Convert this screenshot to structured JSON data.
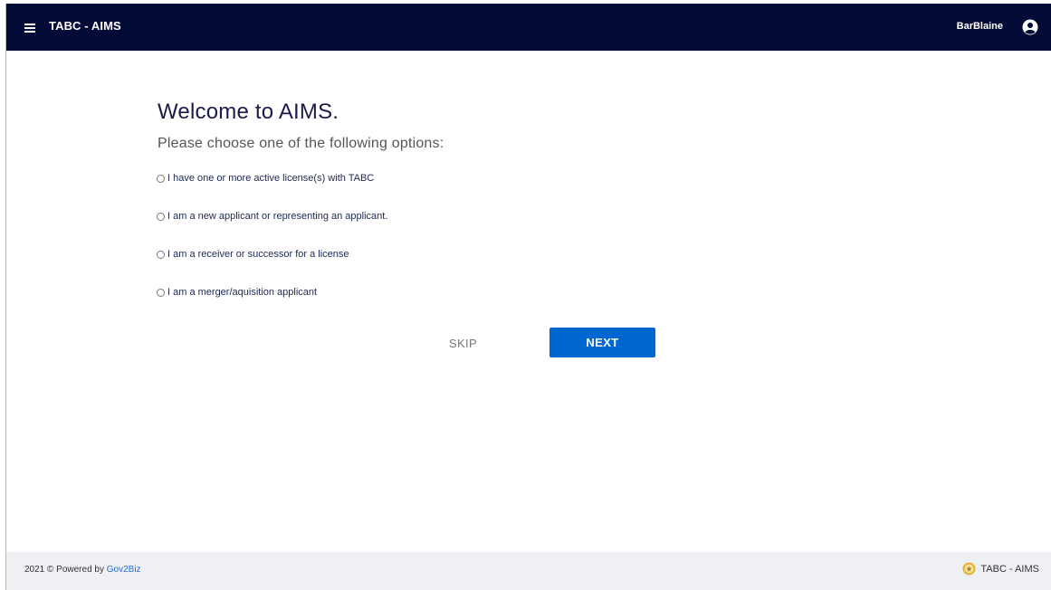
{
  "header": {
    "app_title": "TABC - AIMS",
    "username": "BarBlaine",
    "menu_icon": "hamburger-menu-icon",
    "user_icon": "user-circle-icon",
    "background_color": "#030a36"
  },
  "main": {
    "title": "Welcome to AIMS.",
    "subtitle": "Please choose one of the following options:",
    "options": [
      {
        "label": "I have one or more active license(s) with TABC"
      },
      {
        "label": "I am a new applicant or representing an applicant."
      },
      {
        "label": "I am a receiver or successor for a license"
      },
      {
        "label": "I am a merger/aquisition applicant"
      }
    ],
    "skip_label": "SKIP",
    "next_label": "NEXT",
    "next_color": "#0067d1"
  },
  "footer": {
    "copyright": "2021 © Powered by",
    "link_text": "Gov2Biz",
    "right_label": "TABC - AIMS",
    "seal_icon": "tabc-seal-icon"
  }
}
